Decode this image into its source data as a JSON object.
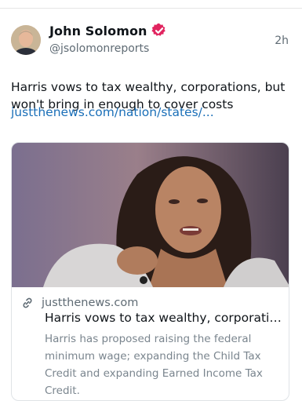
{
  "post": {
    "author": {
      "display_name": "John Solomon",
      "handle": "@jsolomonreports",
      "verified": true,
      "verified_color": "#e1245f"
    },
    "time": "2h",
    "text": "Harris vows to tax wealthy, corporations, but won't bring in enough to cover costs",
    "link_text": "justthenews.com/nation/states/...",
    "link_color": "#1a6fb8",
    "card": {
      "domain": "justthenews.com",
      "title": "Harris vows to tax wealthy, corporatio...",
      "description": "Harris has proposed raising the federal minimum wage; expanding the Child Tax Credit and expanding Earned Income Tax Credit.",
      "link_icon": "link-icon"
    }
  }
}
